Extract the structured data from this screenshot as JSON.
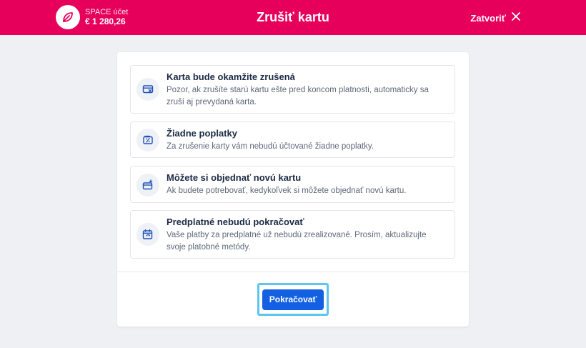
{
  "header": {
    "account_label": "SPACE účet",
    "account_balance": "€ 1 280,26",
    "title": "Zrušiť kartu",
    "close_label": "Zatvoriť",
    "logo_icon": "leaf-icon",
    "close_icon": "close-icon"
  },
  "cards": [
    {
      "icon": "card-cancel-icon",
      "title": "Karta bude okamžite zrušená",
      "description": "Pozor, ak zrušíte starú kartu ešte pred koncom platnosti, automaticky sa zruší aj prevydaná karta."
    },
    {
      "icon": "percent-wallet-icon",
      "title": "Žiadne poplatky",
      "description": "Za zrušenie karty vám nebudú účtované žiadne poplatky."
    },
    {
      "icon": "new-card-icon",
      "title": "Môžete si objednať novú kartu",
      "description": "Ak budete potrebovať, kedykoľvek si môžete objednať novú kartu."
    },
    {
      "icon": "calendar-repeat-icon",
      "title": "Predplatné nebudú pokračovať",
      "description": "Vaše platby za predplatné už nebudú zrealizované. Prosím, aktualizujte svoje platobné metódy."
    }
  ],
  "footer": {
    "continue_label": "Pokračovať"
  },
  "colors": {
    "brand": "#e6005c",
    "primary_button": "#1360e2",
    "focus_ring": "#5cc6ef",
    "icon_blue": "#1d4fb8"
  }
}
